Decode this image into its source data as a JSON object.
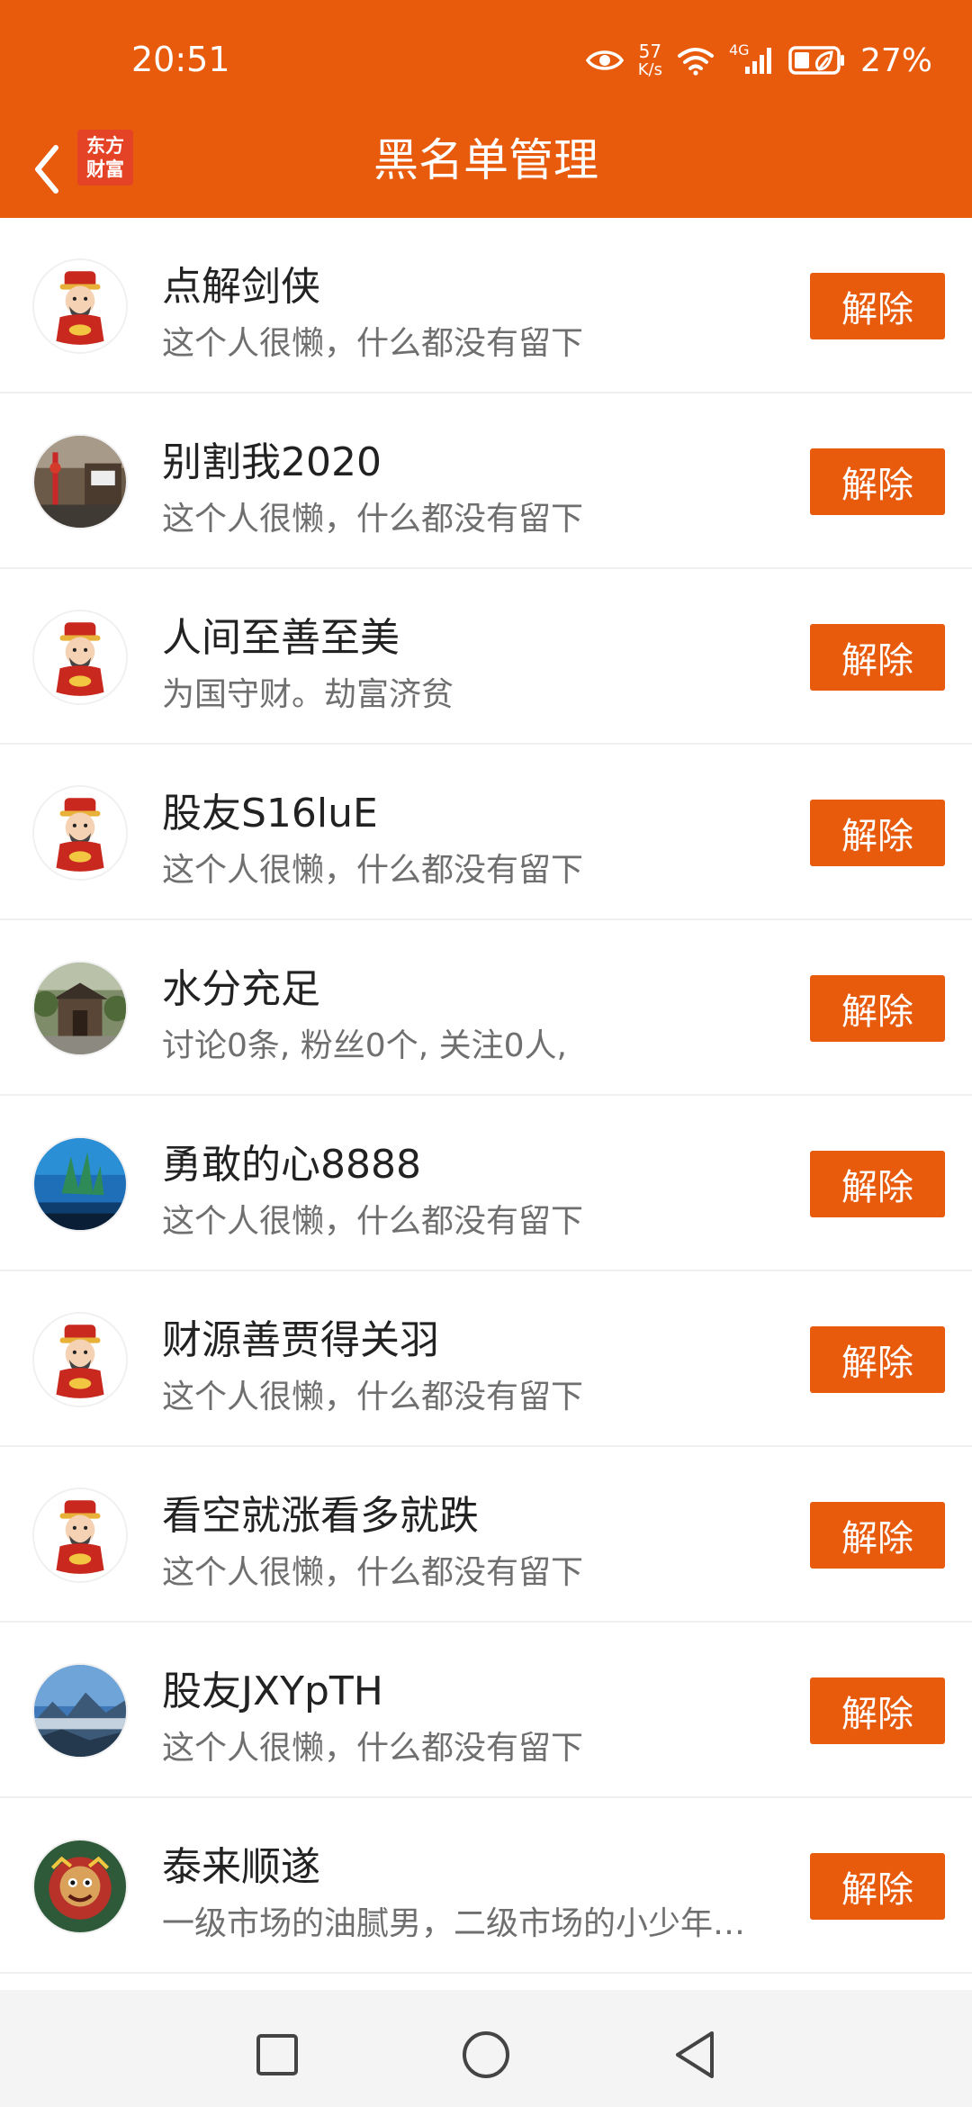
{
  "status": {
    "time": "20:51",
    "net_speed_value": "57",
    "net_speed_unit": "K/s",
    "network_type": "4G",
    "battery": "27%",
    "icons": [
      "eye-icon",
      "wifi-icon",
      "signal-icon",
      "battery-icon"
    ]
  },
  "header": {
    "title": "黑名单管理",
    "brand_line1": "东方",
    "brand_line2": "财富",
    "back_icon": "chevron-left-icon"
  },
  "theme": {
    "accent": "#E85A0C",
    "brand_red": "#E44326"
  },
  "blocked_users": [
    {
      "name": "点解剑侠",
      "bio": "这个人很懒，什么都没有留下",
      "action": "解除",
      "avatar": "god-of-wealth-avatar"
    },
    {
      "name": "别割我2020",
      "bio": "这个人很懒，什么都没有留下",
      "action": "解除",
      "avatar": "photo-avatar-street"
    },
    {
      "name": "人间至善至美",
      "bio": "为国守财。劫富济贫",
      "action": "解除",
      "avatar": "god-of-wealth-avatar"
    },
    {
      "name": "股友S16luE",
      "bio": "这个人很懒，什么都没有留下",
      "action": "解除",
      "avatar": "god-of-wealth-avatar"
    },
    {
      "name": "水分充足",
      "bio": "讨论0条, 粉丝0个, 关注0人,",
      "action": "解除",
      "avatar": "photo-avatar-building"
    },
    {
      "name": "勇敢的心8888",
      "bio": "这个人很懒，什么都没有留下",
      "action": "解除",
      "avatar": "photo-avatar-aquarium"
    },
    {
      "name": "财源善贾得关羽",
      "bio": "这个人很懒，什么都没有留下",
      "action": "解除",
      "avatar": "god-of-wealth-avatar"
    },
    {
      "name": "看空就涨看多就跌",
      "bio": "这个人很懒，什么都没有留下",
      "action": "解除",
      "avatar": "god-of-wealth-avatar"
    },
    {
      "name": "股友JXYpTH",
      "bio": "这个人很懒，什么都没有留下",
      "action": "解除",
      "avatar": "photo-avatar-mountains"
    },
    {
      "name": "泰来顺遂",
      "bio": "一级市场的油腻男，二级市场的小少年…",
      "action": "解除",
      "avatar": "photo-avatar-lion-dance"
    }
  ],
  "system_nav": {
    "recent_icon": "square-icon",
    "home_icon": "circle-icon",
    "back_icon": "triangle-back-icon"
  }
}
